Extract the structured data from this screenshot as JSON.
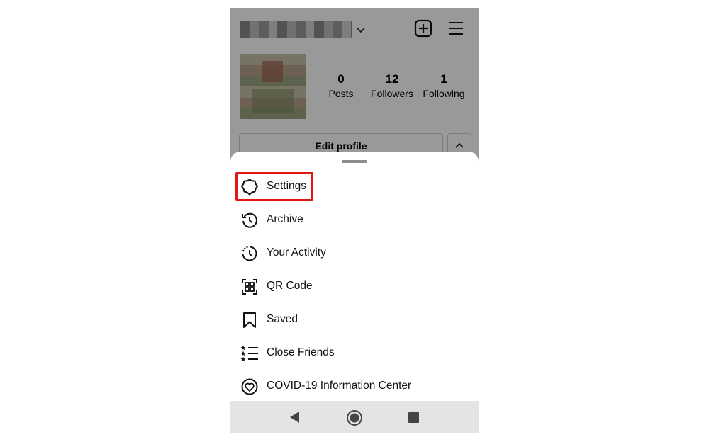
{
  "profile": {
    "stats": {
      "posts": {
        "value": "0",
        "label": "Posts"
      },
      "followers": {
        "value": "12",
        "label": "Followers"
      },
      "following": {
        "value": "1",
        "label": "Following"
      }
    },
    "edit_profile_label": "Edit profile"
  },
  "menu": {
    "items": [
      {
        "label": "Settings",
        "icon": "settings-icon"
      },
      {
        "label": "Archive",
        "icon": "archive-icon"
      },
      {
        "label": "Your Activity",
        "icon": "activity-icon"
      },
      {
        "label": "QR Code",
        "icon": "qr-code-icon"
      },
      {
        "label": "Saved",
        "icon": "bookmark-icon"
      },
      {
        "label": "Close Friends",
        "icon": "close-friends-icon"
      },
      {
        "label": "COVID-19 Information Center",
        "icon": "covid-info-icon"
      }
    ],
    "highlighted": "Settings"
  },
  "colors": {
    "highlight": "#e31616",
    "nav_bar": "#e4e4e4"
  }
}
